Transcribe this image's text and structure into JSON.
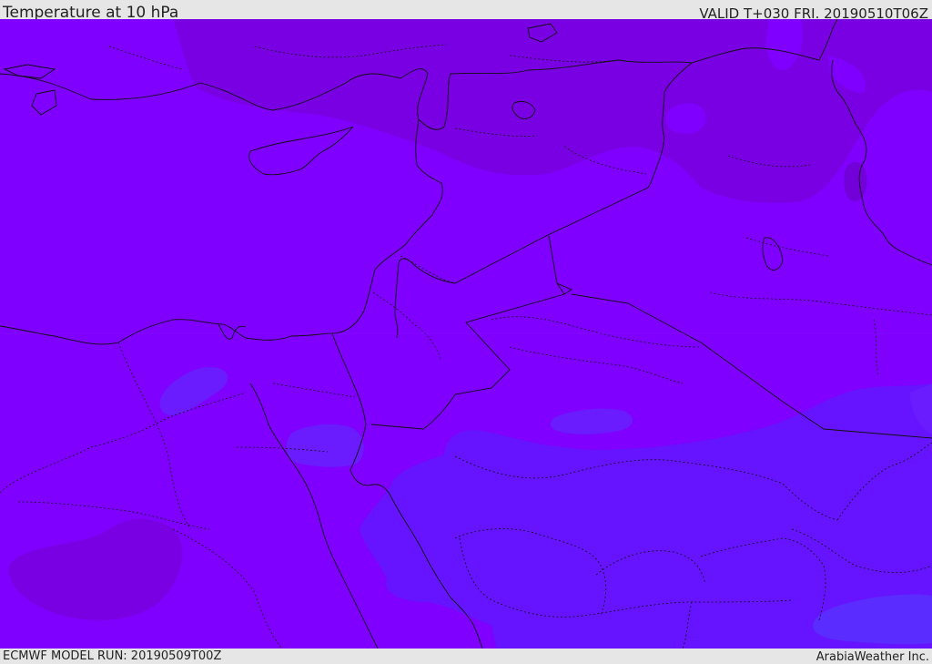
{
  "header": {
    "title": "Temperature at 10 hPa",
    "valid": "VALID T+030 FRI. 20190510T06Z"
  },
  "footer": {
    "model_run": "ECMWF MODEL RUN: 20190509T00Z",
    "credit": "ArabiaWeather Inc."
  },
  "map": {
    "base_color": "#7f00ff",
    "cold_color": "#7a00e4",
    "warm_color": "#6614ff",
    "warmest_color": "#5a2cff",
    "border_color": "#111111"
  }
}
